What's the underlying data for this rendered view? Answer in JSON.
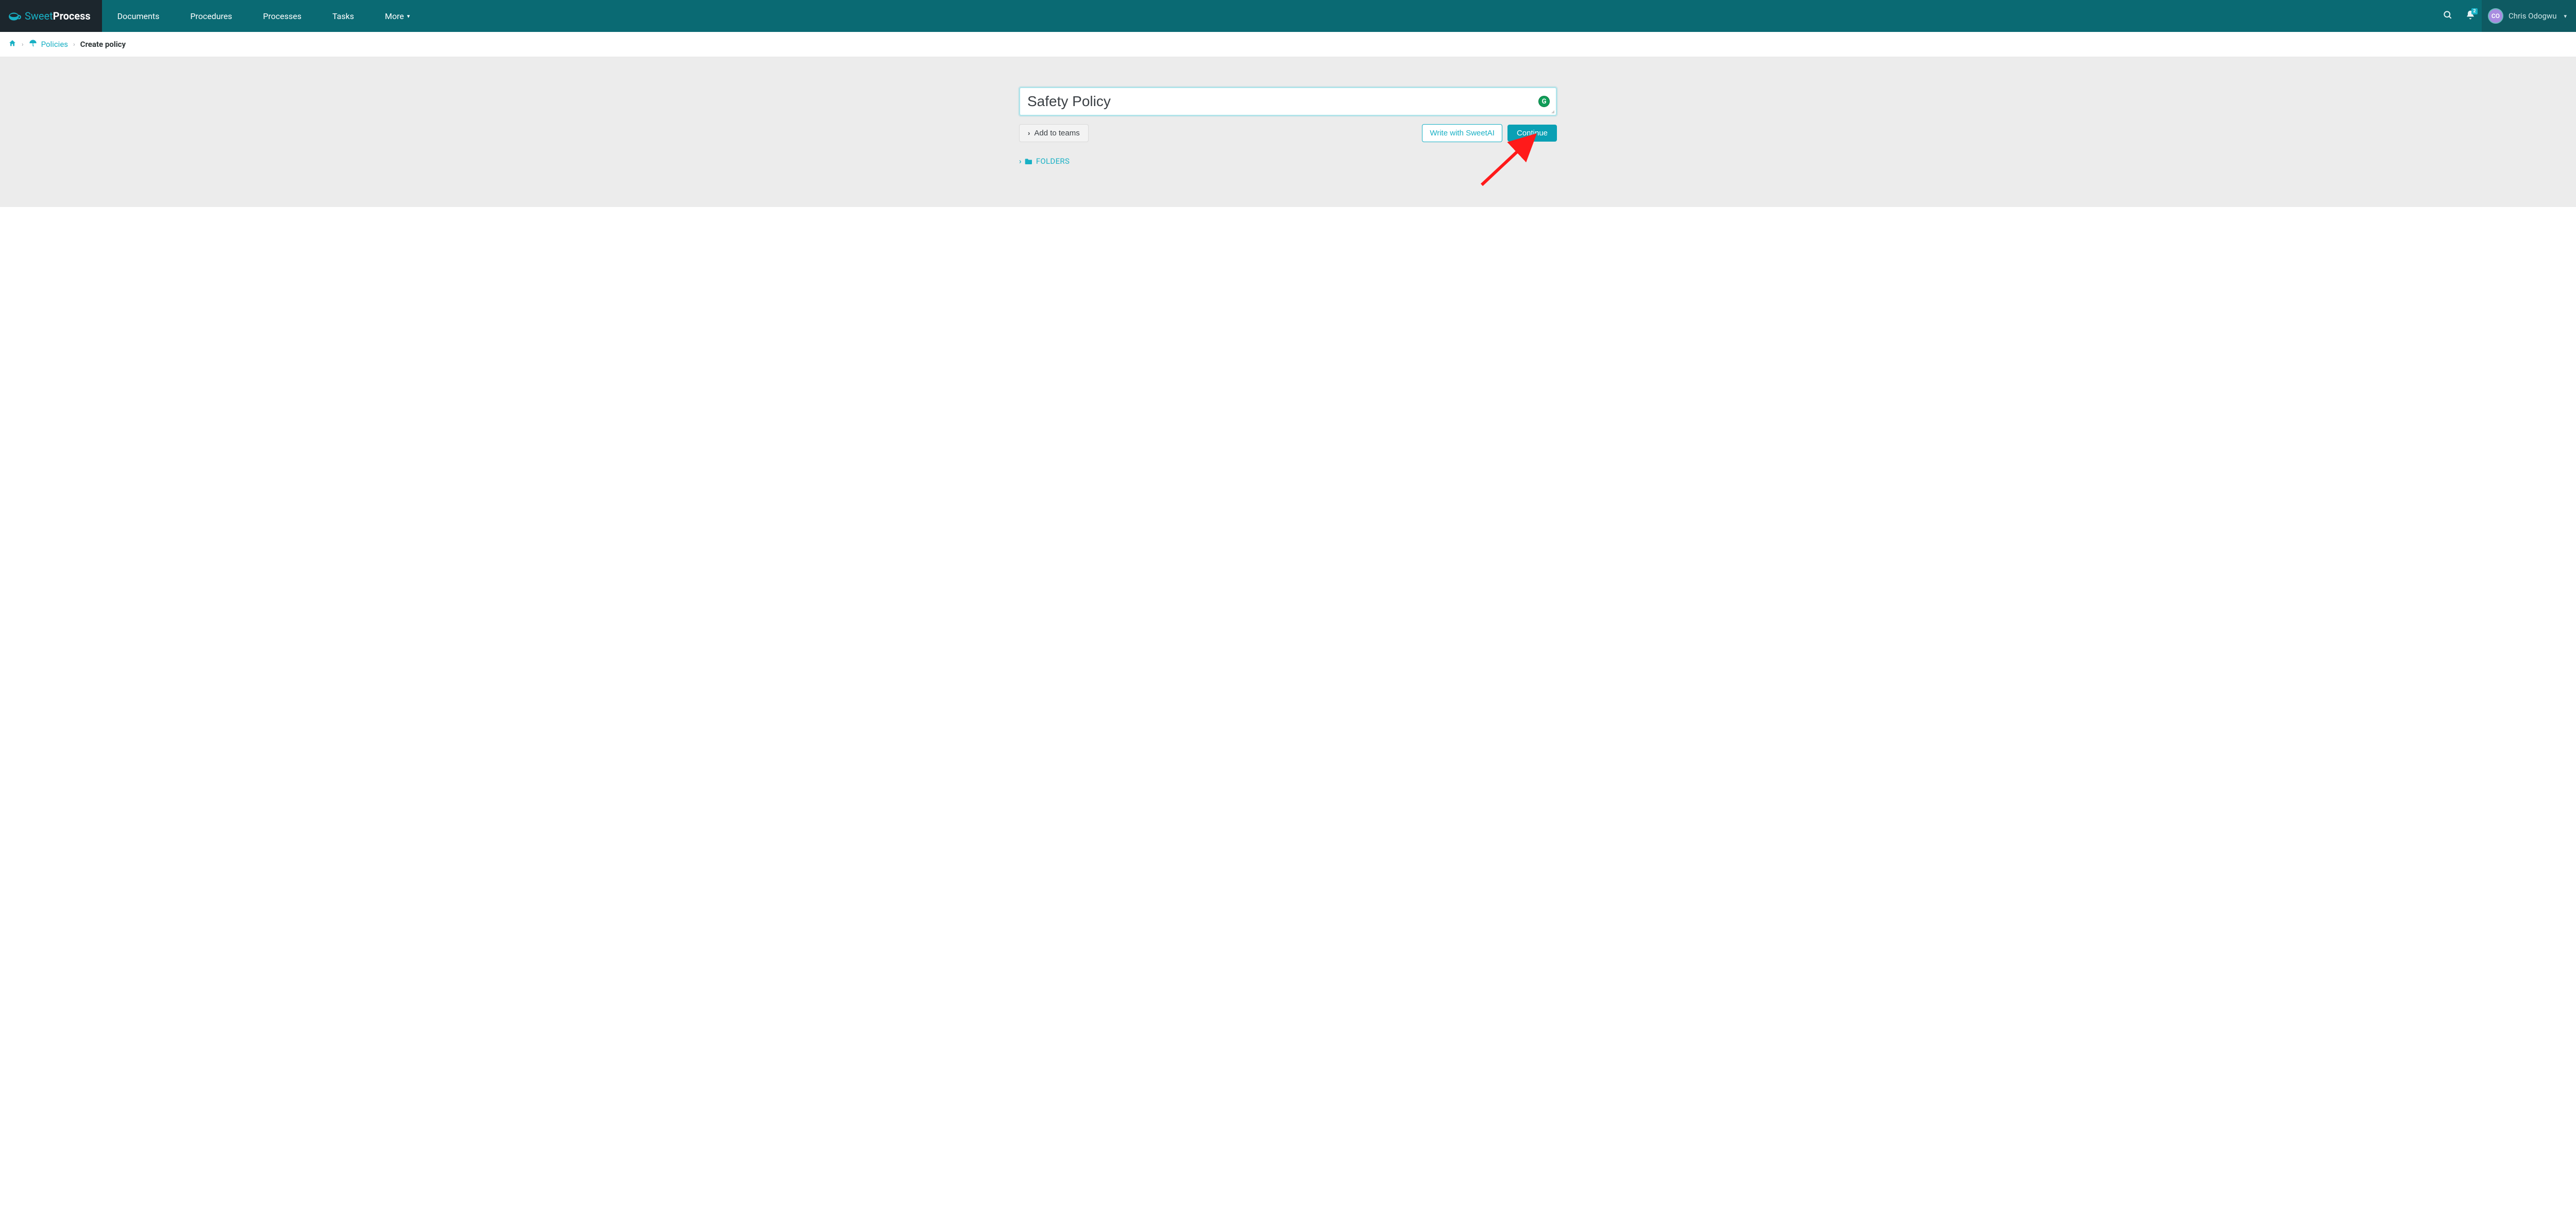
{
  "brand": {
    "weak": "Sweet",
    "strong": "Process"
  },
  "nav": {
    "documents": "Documents",
    "procedures": "Procedures",
    "processes": "Processes",
    "tasks": "Tasks",
    "more": "More"
  },
  "notifications": {
    "count": "2"
  },
  "user": {
    "initials": "CO",
    "name": "Chris Odogwu"
  },
  "breadcrumb": {
    "policies": "Policies",
    "current": "Create policy"
  },
  "form": {
    "title_value": "Safety Policy",
    "add_to_teams": "Add to teams",
    "write_ai": "Write with SweetAI",
    "continue": "Continue",
    "folders": "FOLDERS",
    "grammarly_glyph": "G"
  }
}
